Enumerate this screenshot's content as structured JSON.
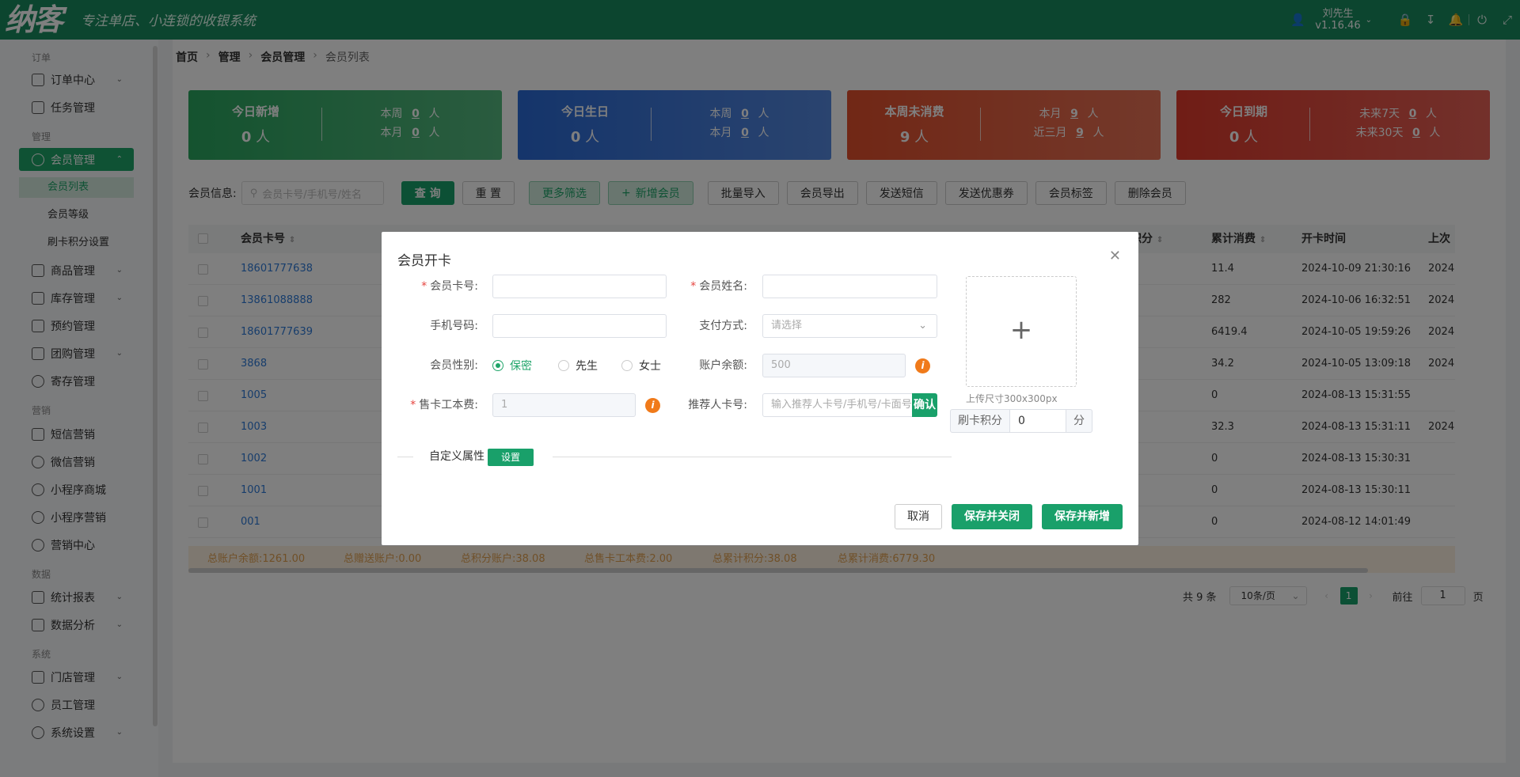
{
  "topbar": {
    "logo": "纳客",
    "slogan": "专注单店、小连锁的收银系统",
    "user_name": "刘先生",
    "version": "v1.16.46"
  },
  "sidebar": {
    "sections": [
      {
        "label": "订单",
        "items": [
          {
            "label": "订单中心",
            "expand": true
          },
          {
            "label": "任务管理"
          }
        ]
      },
      {
        "label": "管理",
        "items": [
          {
            "label": "会员管理",
            "expand": true,
            "active": true
          },
          {
            "label": "商品管理",
            "expand": true
          },
          {
            "label": "库存管理",
            "expand": true
          },
          {
            "label": "预约管理"
          },
          {
            "label": "团购管理",
            "expand": true
          },
          {
            "label": "寄存管理"
          }
        ]
      },
      {
        "label": "营销",
        "items": [
          {
            "label": "短信营销"
          },
          {
            "label": "微信营销"
          },
          {
            "label": "小程序商城"
          },
          {
            "label": "小程序营销"
          },
          {
            "label": "营销中心"
          }
        ]
      },
      {
        "label": "数据",
        "items": [
          {
            "label": "统计报表",
            "expand": true
          },
          {
            "label": "数据分析",
            "expand": true
          }
        ]
      },
      {
        "label": "系统",
        "items": [
          {
            "label": "门店管理",
            "expand": true
          },
          {
            "label": "员工管理"
          },
          {
            "label": "系统设置",
            "expand": true
          }
        ]
      }
    ],
    "submenu": [
      "会员列表",
      "会员等级",
      "刷卡积分设置"
    ]
  },
  "breadcrumb": [
    "首页",
    "管理",
    "会员管理",
    "会员列表"
  ],
  "cards": [
    {
      "title": "今日新增",
      "value": "0",
      "unit": "人",
      "r1_label": "本周",
      "r1_value": "0",
      "r2_label": "本月",
      "r2_value": "0",
      "color": "#2aa65f"
    },
    {
      "title": "今日生日",
      "value": "0",
      "unit": "人",
      "r1_label": "本周",
      "r1_value": "0",
      "r2_label": "本月",
      "r2_value": "0",
      "color": "#2a6ad6"
    },
    {
      "title": "本周未消费",
      "value": "9",
      "unit": "人",
      "r1_label": "本月",
      "r1_value": "9",
      "r2_label": "近三月",
      "r2_value": "9",
      "color": "#e24f2c"
    },
    {
      "title": "今日到期",
      "value": "0",
      "unit": "人",
      "r1_label": "未来7天",
      "r1_value": "0",
      "r2_label": "未来30天",
      "r2_value": "0",
      "color": "#e03a2c"
    }
  ],
  "card_unit": "人",
  "filter": {
    "label": "会员信息:",
    "placeholder": "会员卡号/手机号/姓名",
    "buttons": [
      "查 询",
      "重 置",
      "更多筛选",
      "新增会员",
      "批量导入",
      "会员导出",
      "发送短信",
      "发送优惠券",
      "会员标签",
      "删除会员"
    ]
  },
  "table": {
    "headers": [
      "会员卡号",
      "积分",
      "累计消费",
      "开卡时间",
      "上次"
    ],
    "rows": [
      [
        "18601777638",
        "11.4",
        "2024-10-09 21:30:16",
        "2024"
      ],
      [
        "13861088888",
        "282",
        "2024-10-06 16:32:51",
        "2024"
      ],
      [
        "18601777639",
        "6419.4",
        "2024-10-05 19:59:26",
        "2024"
      ],
      [
        "3868",
        "34.2",
        "2024-10-05 13:09:18",
        "2024"
      ],
      [
        "1005",
        "0",
        "2024-08-13 15:31:55",
        ""
      ],
      [
        "1003",
        "32.3",
        "2024-08-13 15:31:11",
        "2024"
      ],
      [
        "1002",
        "0",
        "2024-08-13 15:30:31",
        ""
      ],
      [
        "1001",
        "0",
        "2024-08-13 15:30:11",
        ""
      ],
      [
        "001",
        "0",
        "2024-08-12 14:01:49",
        ""
      ]
    ]
  },
  "summary": [
    "总账户余额:1261.00",
    "总赠送账户:0.00",
    "总积分账户:38.08",
    "总售卡工本费:2.00",
    "总累计积分:38.08",
    "总累计消费:6779.30"
  ],
  "pager": {
    "total": "共 9 条",
    "page_size": "10条/页",
    "current": "1",
    "goto_label": "前往",
    "goto_value": "1",
    "page_suffix": "页"
  },
  "modal": {
    "title": "会员开卡",
    "card_no_label": "会员卡号:",
    "name_label": "会员姓名:",
    "phone_label": "手机号码:",
    "pay_label": "支付方式:",
    "pay_placeholder": "请选择",
    "gender_label": "会员性别:",
    "genders": [
      "保密",
      "先生",
      "女士"
    ],
    "balance_label": "账户余额:",
    "balance_value": "500",
    "fee_label": "售卡工本费:",
    "fee_value": "1",
    "referrer_label": "推荐人卡号:",
    "referrer_placeholder": "输入推荐人卡号/手机号/卡面号",
    "confirm": "确认",
    "upload_tip": "上传尺寸300x300px",
    "points_label": "刷卡积分",
    "points_value": "0",
    "points_unit": "分",
    "custom_label": "自定义属性",
    "custom_btn": "设置",
    "cancel": "取消",
    "save_close": "保存并关闭",
    "save_new": "保存并新增"
  }
}
